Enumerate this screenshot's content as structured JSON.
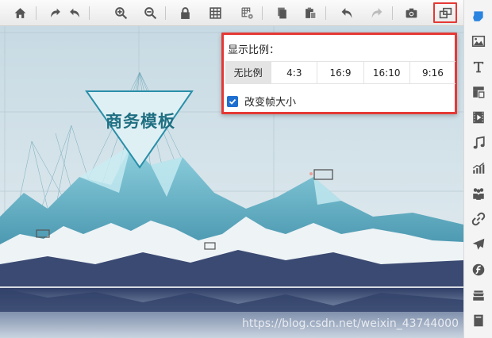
{
  "toolbar": {
    "buttons": [
      {
        "name": "home-icon"
      },
      {
        "name": "rotate-right-icon"
      },
      {
        "name": "rotate-left-icon"
      },
      {
        "name": "zoom-in-icon"
      },
      {
        "name": "zoom-out-icon"
      },
      {
        "name": "lock-icon"
      },
      {
        "name": "grid-icon"
      },
      {
        "name": "grid-settings-icon"
      },
      {
        "name": "copy-icon"
      },
      {
        "name": "paste-icon"
      },
      {
        "name": "undo-icon"
      },
      {
        "name": "redo-icon"
      },
      {
        "name": "camera-icon"
      },
      {
        "name": "aspect-ratio-icon"
      }
    ]
  },
  "canvas": {
    "slide_title": "商务模板",
    "watermark": "https://blog.csdn.net/weixin_43744000"
  },
  "ratio_popup": {
    "label": "显示比例：",
    "options": [
      "无比例",
      "4:3",
      "16:9",
      "16:10",
      "9:16"
    ],
    "selected": "无比例",
    "resize_frame_label": "改变帧大小",
    "resize_frame_checked": true
  },
  "sidebar": {
    "items": [
      "shape-icon",
      "image-icon",
      "text-icon",
      "media-icon",
      "video-icon",
      "music-icon",
      "chart-icon",
      "people-icon",
      "link-icon",
      "airplane-icon",
      "flash-icon",
      "layers-icon",
      "page-icon"
    ]
  },
  "colors": {
    "accent": "#e53935",
    "checkbox": "#1e6fd0",
    "title": "#1f6f82"
  }
}
